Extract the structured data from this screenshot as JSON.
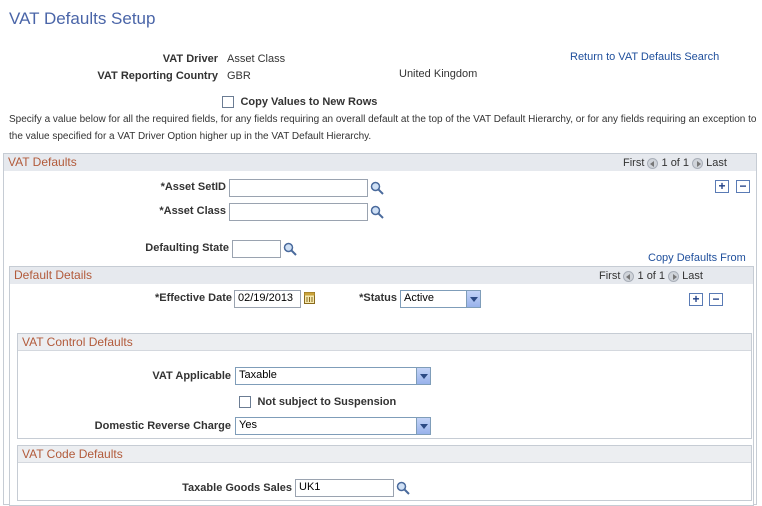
{
  "page": {
    "title": "VAT Defaults Setup",
    "return_link": "Return to VAT Defaults Search",
    "vat_driver_label": "VAT Driver",
    "vat_driver_value": "Asset Class",
    "reporting_country_label": "VAT Reporting Country",
    "reporting_country_code": "GBR",
    "reporting_country_name": "United Kingdom",
    "copy_values_label": "Copy Values to New Rows",
    "instructions": "Specify a value below for all the required fields, for any fields requiring an overall default at the top of the VAT Default Hierarchy, or for any fields requiring an exception to the value specified for a VAT Driver Option higher up in the VAT Default Hierarchy."
  },
  "vat_defaults": {
    "header": "VAT Defaults",
    "pager_first": "First",
    "pager_range": "1 of 1",
    "pager_last": "Last",
    "asset_setid_label": "*Asset SetID",
    "asset_setid_value": "",
    "asset_class_label": "*Asset Class",
    "asset_class_value": "",
    "defaulting_state_label": "Defaulting State",
    "defaulting_state_value": "",
    "copy_defaults_link": "Copy Defaults From",
    "plus": "+",
    "minus": "−"
  },
  "default_details": {
    "header": "Default Details",
    "pager_first": "First",
    "pager_range": "1 of 1",
    "pager_last": "Last",
    "effective_date_label": "*Effective Date",
    "effective_date_value": "02/19/2013",
    "status_label": "*Status",
    "status_value": "Active",
    "plus": "+",
    "minus": "−"
  },
  "vat_control": {
    "header": "VAT Control Defaults",
    "vat_applicable_label": "VAT Applicable",
    "vat_applicable_value": "Taxable",
    "suspension_label": "Not subject to Suspension",
    "reverse_charge_label": "Domestic Reverse Charge",
    "reverse_charge_value": "Yes"
  },
  "vat_code": {
    "header": "VAT Code Defaults",
    "taxable_goods_label": "Taxable Goods Sales",
    "taxable_goods_value": "UK1"
  },
  "icons": {
    "lookup": "magnifier-icon",
    "calendar": "calendar-icon",
    "prev": "prev-arrow-icon",
    "next": "next-arrow-icon"
  }
}
